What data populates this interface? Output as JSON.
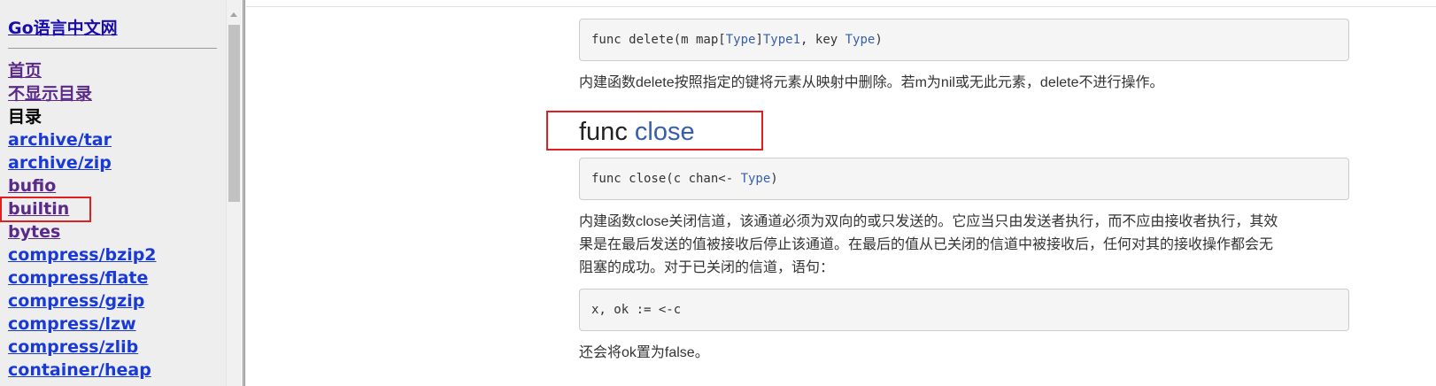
{
  "sidebar": {
    "site_title": "Go语言中文网",
    "links_top": [
      {
        "label": "首页"
      },
      {
        "label": "不显示目录"
      }
    ],
    "heading": "目录",
    "packages": [
      {
        "label": "archive/tar"
      },
      {
        "label": "archive/zip"
      },
      {
        "label": "bufio"
      },
      {
        "label": "builtin"
      },
      {
        "label": "bytes"
      },
      {
        "label": "compress/bzip2"
      },
      {
        "label": "compress/flate"
      },
      {
        "label": "compress/gzip"
      },
      {
        "label": "compress/lzw"
      },
      {
        "label": "compress/zlib"
      },
      {
        "label": "container/heap"
      }
    ]
  },
  "content": {
    "delete_code": {
      "prefix": "func delete(m map[",
      "t1": "Type",
      "mid1": "]",
      "t2": "Type1",
      "mid2": ", key ",
      "t3": "Type",
      "suffix": ")"
    },
    "delete_desc": "内建函数delete按照指定的键将元素从映射中删除。若m为nil或无此元素，delete不进行操作。",
    "close_heading": {
      "keyword": "func ",
      "name": "close"
    },
    "close_code": {
      "prefix": "func close(c chan<- ",
      "type": "Type",
      "suffix": ")"
    },
    "close_desc_lines": [
      "内建函数close关闭信道，该通道必须为双向的或只发送的。它应当只由发送者执行，而不应由接收者执行，其效",
      "果是在最后发送的值被接收后停止该通道。在最后的值从已关闭的信道中被接收后，任何对其的接收操作都会无",
      "阻塞的成功。对于已关闭的信道，语句："
    ],
    "example_code": "x, ok := <-c",
    "after_desc": "还会将ok置为false。"
  },
  "colors": {
    "link": "#1a3ad6",
    "visited_link": "#5a2a8a",
    "type_highlight": "#375eab",
    "highlight_box": "#e02020"
  }
}
